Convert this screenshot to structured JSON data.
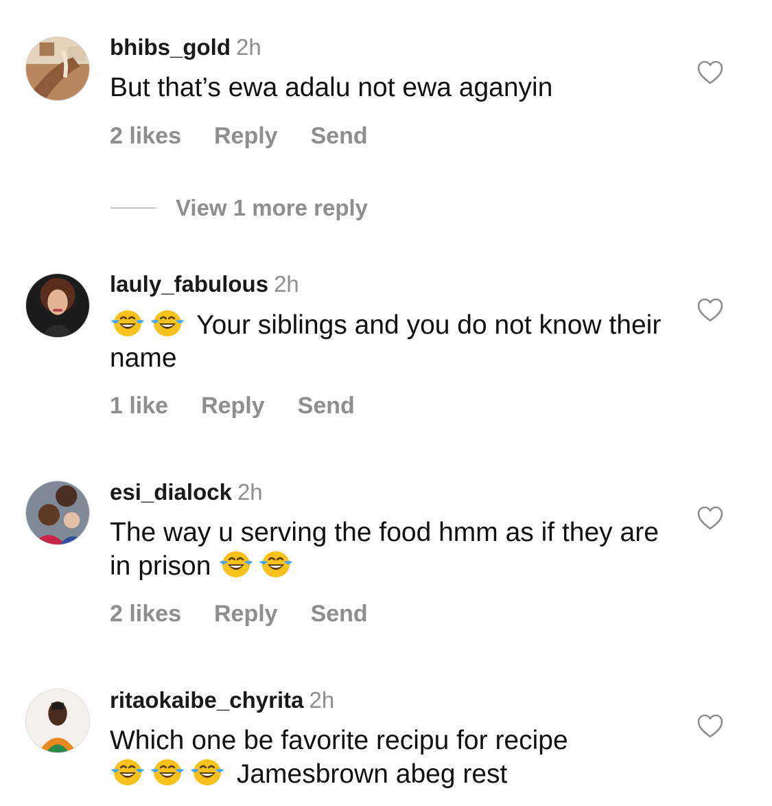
{
  "comments": [
    {
      "username": "bhibs_gold",
      "time": "2h",
      "text": "But that’s ewa adalu not ewa aganyin",
      "likes": "2 likes",
      "reply": "Reply",
      "send": "Send",
      "view_more": "View 1 more reply"
    },
    {
      "username": "lauly_fabulous",
      "time": "2h",
      "text_after_emoji": "Your siblings and you do not know their name",
      "emoji": "face-with-tears-of-joy",
      "likes": "1 like",
      "reply": "Reply",
      "send": "Send"
    },
    {
      "username": "esi_dialock",
      "time": "2h",
      "text": "The way u serving the food hmm as if they are in prison",
      "emoji": "face-with-tears-of-joy",
      "likes": "2 likes",
      "reply": "Reply",
      "send": "Send"
    },
    {
      "username": "ritaokaibe_chyrita",
      "time": "2h",
      "text_line1": "Which one be favorite recipu for recipe",
      "text_after_emoji": "Jamesbrown abeg rest",
      "emoji": "face-with-tears-of-joy"
    }
  ],
  "colors": {
    "secondary_text": "#8e8e8e",
    "primary_text": "#111111",
    "emoji_face": "#f7c21b",
    "emoji_tears": "#4aa8f0"
  },
  "icons": {
    "like": "heart-outline-icon"
  }
}
